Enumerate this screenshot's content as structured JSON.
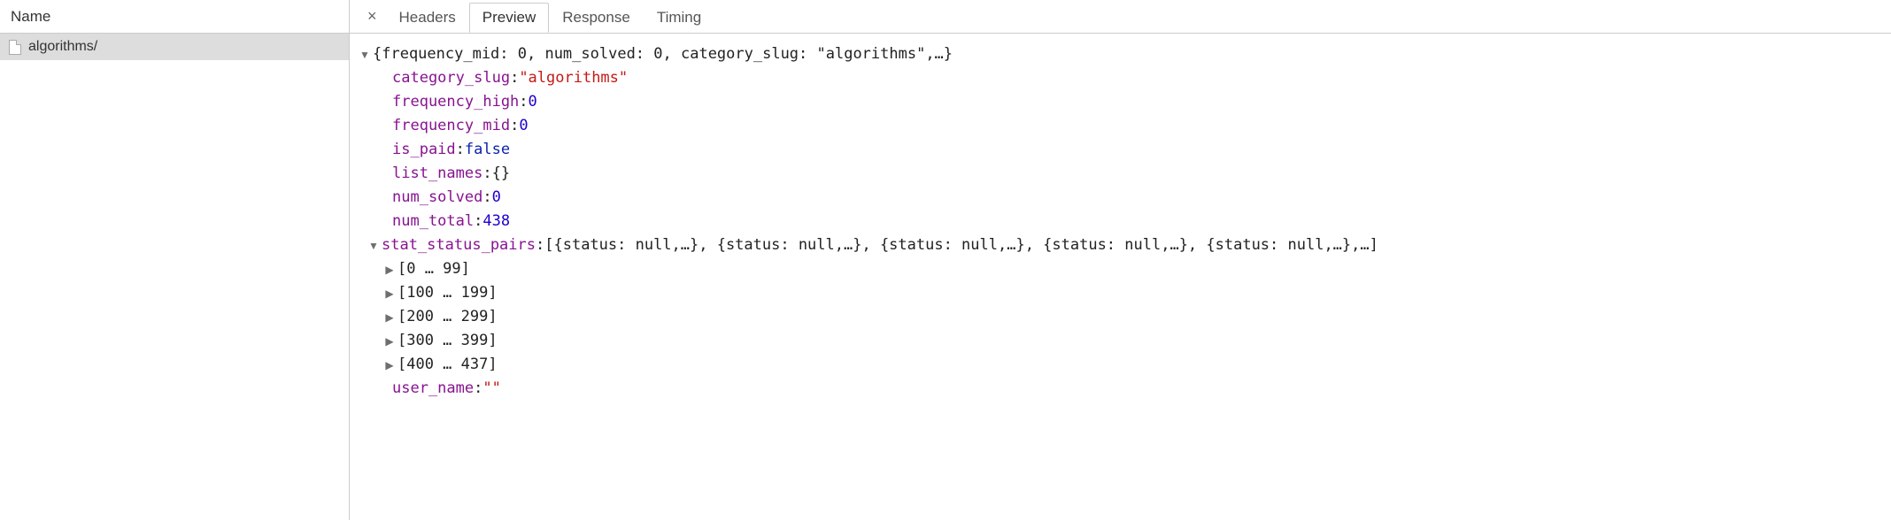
{
  "left": {
    "header": "Name",
    "items": [
      "algorithms/"
    ]
  },
  "tabs": {
    "close": "×",
    "items": [
      "Headers",
      "Preview",
      "Response",
      "Timing"
    ],
    "active": "Preview"
  },
  "tree": {
    "root_summary": "{frequency_mid: 0, num_solved: 0, category_slug: \"algorithms\",…}",
    "props": {
      "category_slug": {
        "key": "category_slug",
        "val": "\"algorithms\"",
        "type": "string"
      },
      "frequency_high": {
        "key": "frequency_high",
        "val": "0",
        "type": "number"
      },
      "frequency_mid": {
        "key": "frequency_mid",
        "val": "0",
        "type": "number"
      },
      "is_paid": {
        "key": "is_paid",
        "val": "false",
        "type": "boolean"
      },
      "list_names": {
        "key": "list_names",
        "val": "{}",
        "type": "plain"
      },
      "num_solved": {
        "key": "num_solved",
        "val": "0",
        "type": "number"
      },
      "num_total": {
        "key": "num_total",
        "val": "438",
        "type": "number"
      },
      "user_name": {
        "key": "user_name",
        "val": "\"\"",
        "type": "string"
      }
    },
    "stat_status_pairs": {
      "key": "stat_status_pairs",
      "summary": "[{status: null,…}, {status: null,…}, {status: null,…}, {status: null,…}, {status: null,…},…]",
      "ranges": [
        "[0 … 99]",
        "[100 … 199]",
        "[200 … 299]",
        "[300 … 399]",
        "[400 … 437]"
      ]
    }
  }
}
